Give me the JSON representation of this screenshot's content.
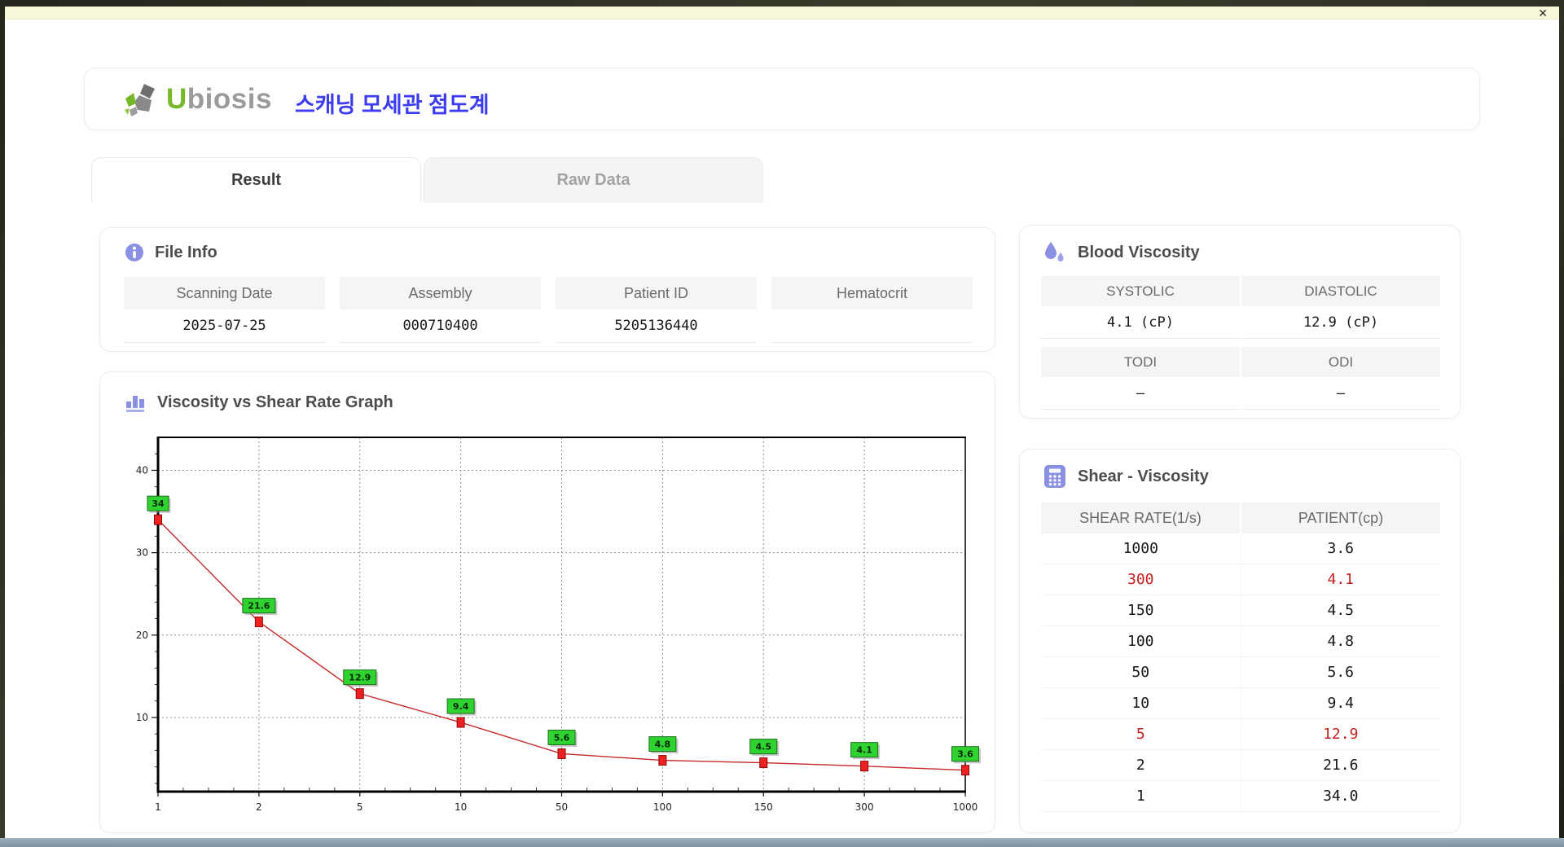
{
  "window": {
    "close_label": "✕"
  },
  "header": {
    "logo_accent": "U",
    "logo_rest": "biosis",
    "app_title_korean": "스캐닝 모세관 점도계"
  },
  "tabs": [
    {
      "label": "Result",
      "active": true
    },
    {
      "label": "Raw Data",
      "active": false
    }
  ],
  "file_info": {
    "title": "File Info",
    "fields": [
      {
        "label": "Scanning Date",
        "value": "2025-07-25"
      },
      {
        "label": "Assembly",
        "value": "000710400"
      },
      {
        "label": "Patient ID",
        "value": "5205136440"
      },
      {
        "label": "Hematocrit",
        "value": ""
      }
    ]
  },
  "blood_viscosity": {
    "title": "Blood Viscosity",
    "cells": [
      {
        "label": "SYSTOLIC",
        "value": "4.1 (cP)"
      },
      {
        "label": "DIASTOLIC",
        "value": "12.9 (cP)"
      },
      {
        "label": "TODI",
        "value": "–"
      },
      {
        "label": "ODI",
        "value": "–"
      }
    ]
  },
  "graph_section": {
    "title": "Viscosity vs Shear Rate Graph"
  },
  "chart_data": {
    "type": "line",
    "title": "Viscosity vs Shear Rate Graph",
    "x_categories": [
      "1",
      "2",
      "5",
      "10",
      "50",
      "100",
      "150",
      "300",
      "1000"
    ],
    "series": [
      {
        "name": "PATIENT",
        "values": [
          34,
          21.6,
          12.9,
          9.4,
          5.6,
          4.8,
          4.5,
          4.1,
          3.6
        ]
      }
    ],
    "point_labels": [
      "34",
      "21.6",
      "12.9",
      "9.4",
      "5.6",
      "4.8",
      "4.5",
      "4.1",
      "3.6"
    ],
    "y_ticks": [
      10,
      20,
      30,
      40
    ],
    "ylim": [
      1,
      44
    ],
    "x_axis_type": "ordinal-equal-spacing",
    "grid": "dashed",
    "legend": "none",
    "line_color": "#c62828",
    "marker_color": "#ee2020",
    "marker_border": "#8a0a0a",
    "grid_color": "#8f8f8f",
    "label_box_fill": "#2fd32f",
    "label_box_border": "#1d6f1d",
    "label_text_color": "#062806"
  },
  "shear_table": {
    "title": "Shear - Viscosity",
    "columns": [
      "SHEAR RATE(1/s)",
      "PATIENT(cp)"
    ],
    "rows": [
      {
        "shear": "1000",
        "patient": "3.6",
        "highlight": false
      },
      {
        "shear": "300",
        "patient": "4.1",
        "highlight": true
      },
      {
        "shear": "150",
        "patient": "4.5",
        "highlight": false
      },
      {
        "shear": "100",
        "patient": "4.8",
        "highlight": false
      },
      {
        "shear": "50",
        "patient": "5.6",
        "highlight": false
      },
      {
        "shear": "10",
        "patient": "9.4",
        "highlight": false
      },
      {
        "shear": "5",
        "patient": "12.9",
        "highlight": true
      },
      {
        "shear": "2",
        "patient": "21.6",
        "highlight": false
      },
      {
        "shear": "1",
        "patient": "34.0",
        "highlight": false
      }
    ]
  },
  "colors": {
    "accent_purple": "#8a90e2",
    "korean_title_blue": "#3c3cf0",
    "logo_green": "#76b82a",
    "logo_gray": "#9b9b9b",
    "highlight_red": "#c81e1e",
    "titlebar_yellow": "#f7f7da",
    "section_header_bg": "#f5f5f6"
  }
}
